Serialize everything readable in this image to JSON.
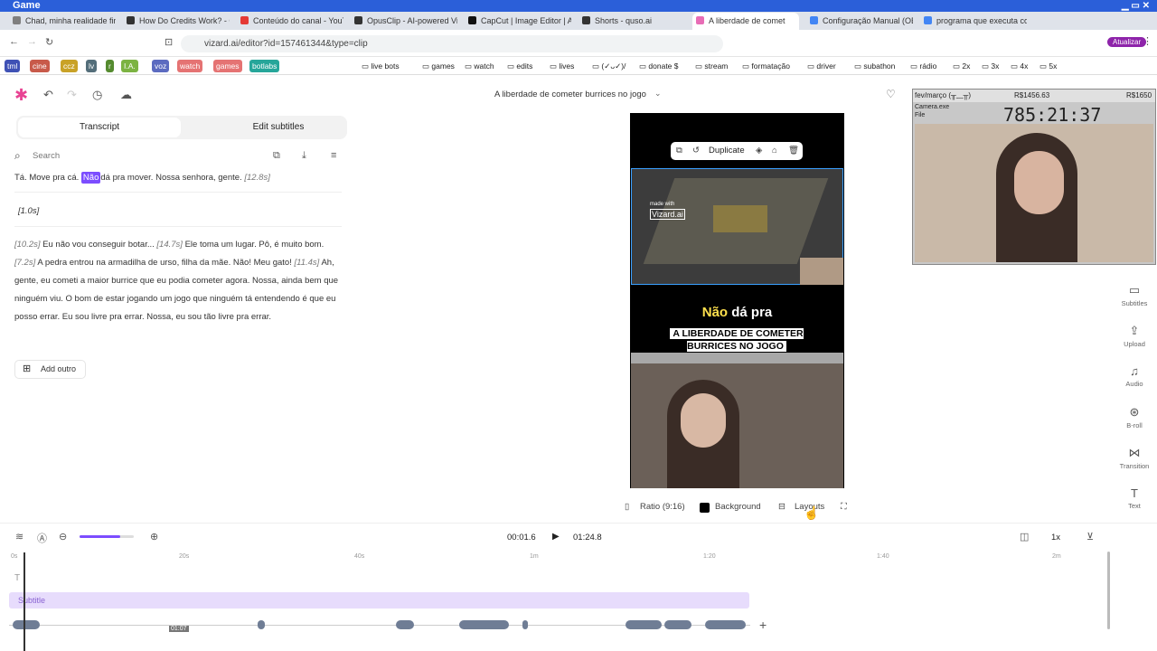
{
  "window": {
    "title": "Game"
  },
  "tabs": [
    {
      "label": "Chad, minha realidade fin",
      "color": "#7f7f7f"
    },
    {
      "label": "How Do Credits Work? - O",
      "color": "#333"
    },
    {
      "label": "Conteúdo do canal - YouT",
      "color": "#e53935"
    },
    {
      "label": "OpusClip - AI-powered Vi",
      "color": "#333"
    },
    {
      "label": "CapCut | Image Editor | AI",
      "color": "#111"
    },
    {
      "label": "Shorts - quso.ai",
      "color": "#333"
    },
    {
      "label": "A liberdade de comet",
      "color": "#e86db6"
    },
    {
      "label": "Configuração Manual (OB",
      "color": "#4285f4"
    },
    {
      "label": "programa que executa co",
      "color": "#4285f4"
    }
  ],
  "browser": {
    "url": "vizard.ai/editor?id=157461344&type=clip"
  },
  "bookmarks": [
    {
      "label": "tml",
      "color": "#3f51b5"
    },
    {
      "label": "cine",
      "color": "#c85a4a"
    },
    {
      "label": "ccz",
      "color": "#c9a227"
    },
    {
      "label": "lv",
      "color": "#546e7a"
    },
    {
      "label": "r",
      "color": "#558b2f"
    },
    {
      "label": "I.A.",
      "color": "#7cb342"
    },
    {
      "label": "voz",
      "color": "#5c6bc0"
    },
    {
      "label": "watch",
      "color": "#e57373"
    },
    {
      "label": "games",
      "color": "#e57373"
    },
    {
      "label": "botlabs",
      "color": "#26a69a"
    }
  ],
  "bookmark_folders": [
    "live bots",
    "games",
    "watch",
    "edits",
    "lives",
    "(✓ᴗ✓)/",
    "donate $",
    "stream",
    "formatação",
    "driver",
    "subathon",
    "rádio",
    "2x",
    "3x",
    "4x",
    "5x"
  ],
  "update_label": "Atualizar",
  "editor": {
    "project_title": "A liberdade de cometer burrices no jogo",
    "tab_transcript": "Transcript",
    "tab_edit_subtitles": "Edit subtitles",
    "search_placeholder": "Search",
    "line1_pre": "Tá. Move pra cá.",
    "line1_hl": "Não",
    "line1_post": "dá pra mover. Nossa senhora, gente.",
    "line1_ts": "[12.8s]",
    "gap_ts": "[1.0s]",
    "para": [
      {
        "ts": "[10.2s]",
        "text": "Eu não vou conseguir botar..."
      },
      {
        "ts": "[14.7s]",
        "text": "Ele toma um lugar. Pô, é muito bom."
      },
      {
        "ts": "[7.2s]",
        "text": "A pedra entrou na armadilha de urso, filha da mãe. Não! Meu gato!"
      },
      {
        "ts": "[11.4s]",
        "text": "Ah, gente, eu cometi a maior burrice que eu podia cometer agora. Nossa, ainda bem que ninguém viu. O bom de estar jogando um jogo que ninguém tá entendendo é que eu posso errar. Eu sou livre pra errar. Nossa, eu sou tão livre pra errar."
      }
    ],
    "add_outro": "Add outro",
    "duplicate": "Duplicate",
    "watermark": "Vizard.ai",
    "watermark_sub": "made with",
    "caption_top_a": "Não",
    "caption_top_b": "dá pra",
    "caption_main": "A LIBERDADE DE COMETER BURRICES NO JOGO",
    "ratio": "Ratio (9:16)",
    "background": "Background",
    "layouts": "Layouts",
    "side": [
      "Subtitles",
      "Upload",
      "Audio",
      "B-roll",
      "Transition",
      "Text"
    ],
    "time_current": "00:01.6",
    "time_total": "01:24.8",
    "speed": "1x",
    "ticks": [
      "0s",
      "20s",
      "40s",
      "1m",
      "1:20",
      "1:40",
      "2m"
    ],
    "subtitle_track": "Subtitle",
    "clip_time": "01:07",
    "zoom_level": 0.75
  },
  "obs": {
    "header": "fev/março (╥﹏╥)",
    "money_left": "R$1456.63",
    "money_right": "R$1650",
    "camera_label": "Camera.exe",
    "file_label": "File",
    "counter": "785:21:37"
  }
}
